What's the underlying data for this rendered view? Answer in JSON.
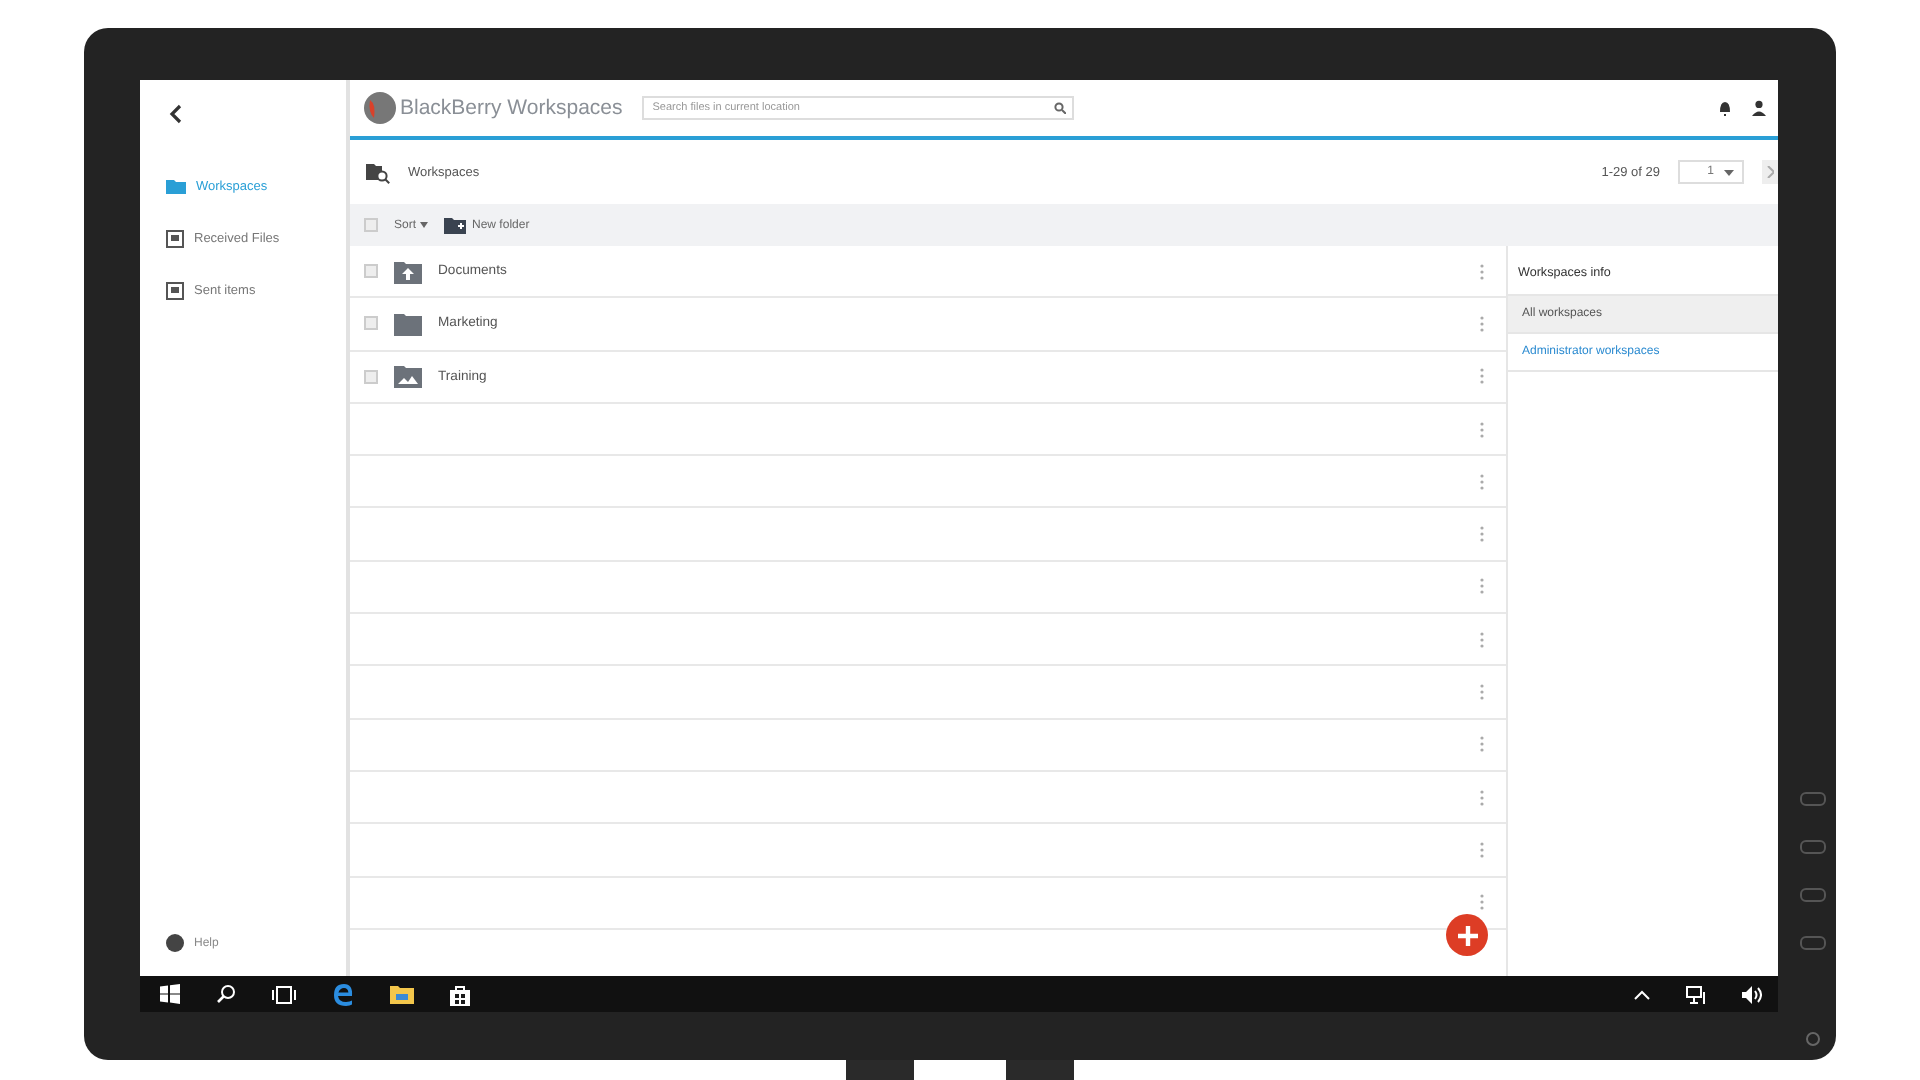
{
  "app": {
    "name": "BlackBerry Workspaces"
  },
  "search": {
    "placeholder": "Search files in current location"
  },
  "sidebar": {
    "items": [
      {
        "label": "Workspaces",
        "selected": true
      },
      {
        "label": "Received Files",
        "selected": false
      },
      {
        "label": "Sent items",
        "selected": false
      }
    ],
    "help": "Help"
  },
  "breadcrumb": "Workspaces",
  "pagination": {
    "range": "1-29 of 29",
    "page": "1"
  },
  "toolbar": {
    "checked": false,
    "sort": "Sort",
    "new_folder": "New folder"
  },
  "rows": [
    {
      "kind": "shared-folder",
      "name": "Documents",
      "checked": false
    },
    {
      "kind": "folder",
      "name": "Marketing",
      "checked": false
    },
    {
      "kind": "photo-folder",
      "name": "Training",
      "checked": false
    },
    {
      "kind": "empty"
    },
    {
      "kind": "empty"
    },
    {
      "kind": "empty"
    },
    {
      "kind": "empty"
    },
    {
      "kind": "empty"
    },
    {
      "kind": "empty"
    },
    {
      "kind": "empty"
    },
    {
      "kind": "empty"
    },
    {
      "kind": "empty"
    },
    {
      "kind": "empty"
    }
  ],
  "info_panel": {
    "title": "Workspaces info",
    "items": [
      {
        "label": "All workspaces",
        "selected": true
      },
      {
        "label": "Administrator workspaces",
        "selected": false
      }
    ]
  }
}
